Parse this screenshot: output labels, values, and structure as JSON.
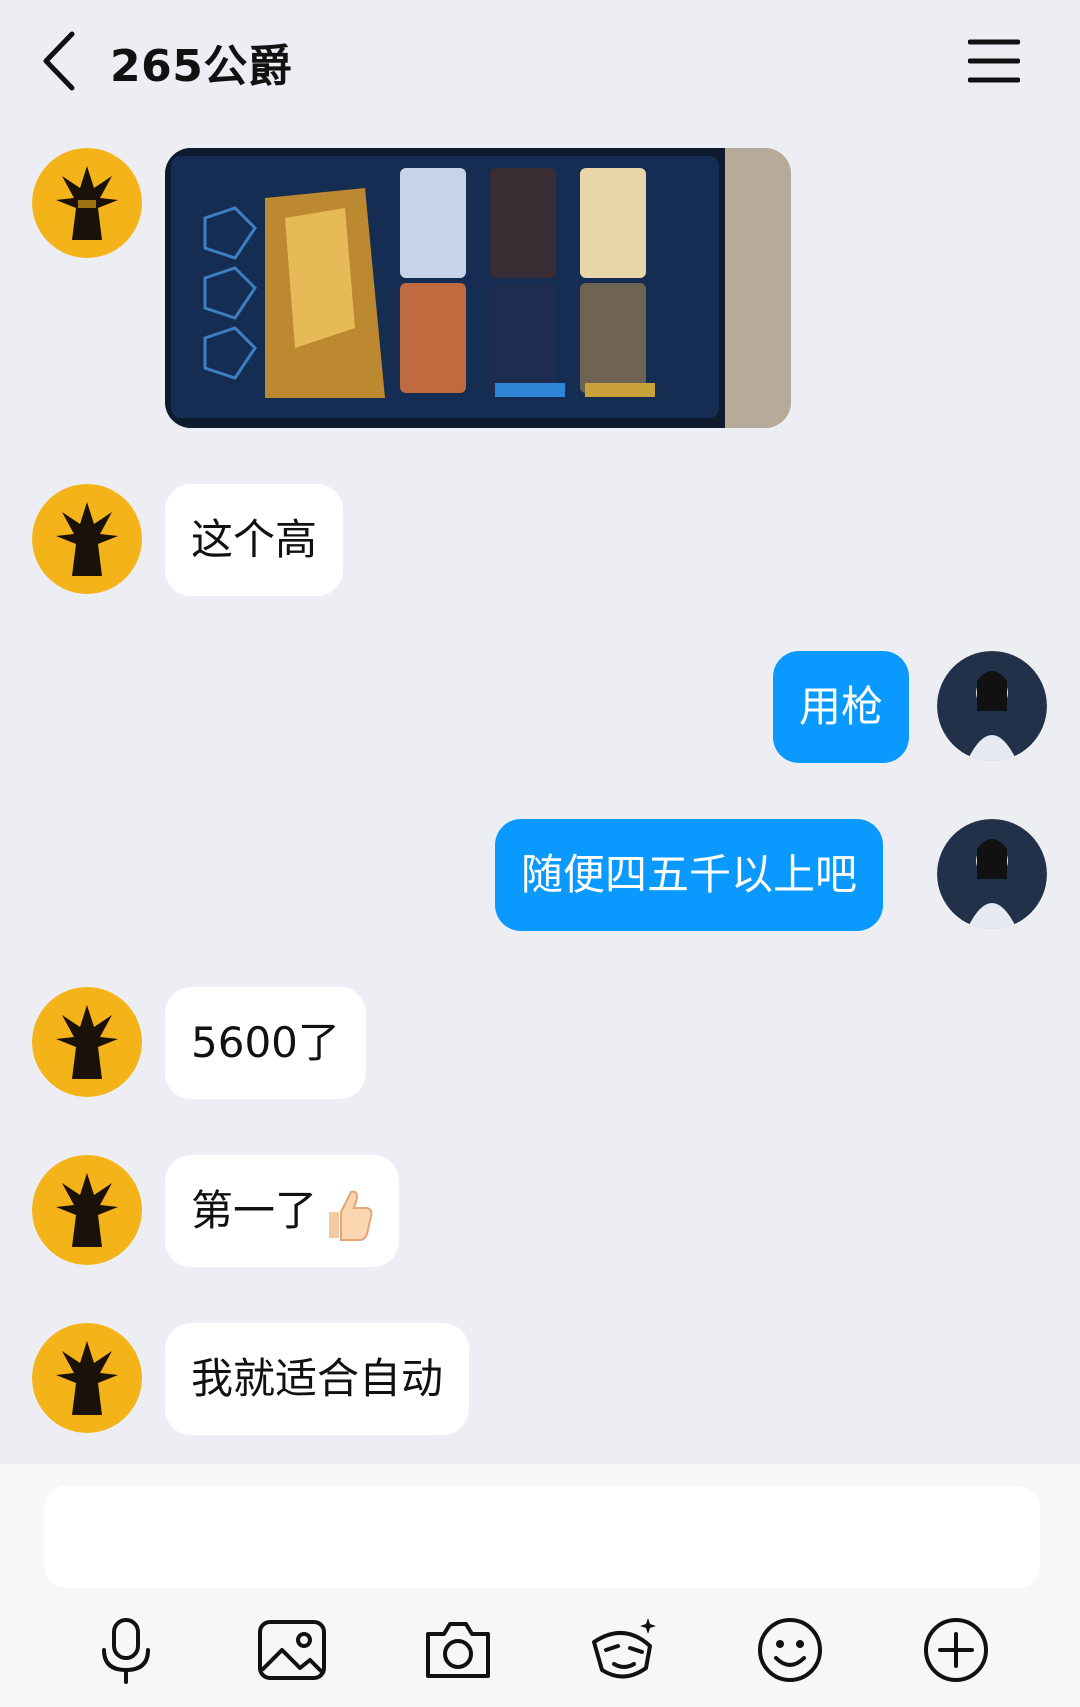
{
  "header": {
    "title": "265公爵"
  },
  "messages": [
    {
      "side": "in",
      "type": "image",
      "description_icon": "game-screenshot-image"
    },
    {
      "side": "in",
      "type": "text",
      "text": "这个高"
    },
    {
      "side": "out",
      "type": "text",
      "text": "用枪"
    },
    {
      "side": "out",
      "type": "text",
      "text": "随便四五千以上吧"
    },
    {
      "side": "in",
      "type": "text",
      "text": "5600了"
    },
    {
      "side": "in",
      "type": "text",
      "text": "第一了",
      "emoji": "thumbs-up"
    },
    {
      "side": "in",
      "type": "text",
      "text": "我就适合自动"
    }
  ],
  "composer": {
    "input_value": "",
    "tools": [
      "microphone-icon",
      "image-icon",
      "camera-icon",
      "sticker-icon",
      "emoji-icon",
      "plus-icon"
    ]
  },
  "colors": {
    "background": "#eceef4",
    "outgoing_bubble": "#0a99ff",
    "incoming_bubble": "#ffffff",
    "avatar_left_bg": "#f5b31a"
  }
}
